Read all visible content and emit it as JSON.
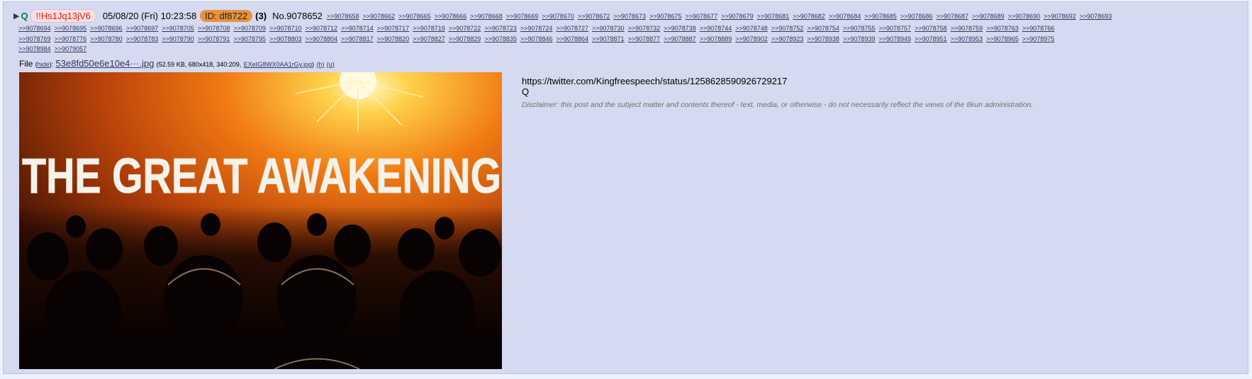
{
  "post": {
    "toggle_glyph": "▶",
    "name": "Q",
    "tripcode": "!!Hs1Jq13jV6",
    "datetime": "05/08/20 (Fri) 10:23:58",
    "id_label": "ID: df8722",
    "id_count": "(3)",
    "post_number": "No.9078652"
  },
  "backlinks": [
    [
      ">>9078658",
      ">>9078662",
      ">>9078665",
      ">>9078666",
      ">>9078668",
      ">>9078669",
      ">>9078670",
      ">>9078672",
      ">>9078673",
      ">>9078675",
      ">>9078677",
      ">>9078679",
      ">>9078681",
      ">>9078682",
      ">>9078684",
      ">>9078685",
      ">>9078686",
      ">>9078687",
      ">>9078689",
      ">>9078690",
      ">>9078692",
      ">>9078693"
    ],
    [
      ">>9078694",
      ">>9078695",
      ">>9078696",
      ">>9078697",
      ">>9078705",
      ">>9078708",
      ">>9078709",
      ">>9078710",
      ">>9078712",
      ">>9078714",
      ">>9078717",
      ">>9078719",
      ">>9078722",
      ">>9078723",
      ">>9078724",
      ">>9078727",
      ">>9078730",
      ">>9078732",
      ">>9078738",
      ">>9078744",
      ">>9078748",
      ">>9078752",
      ">>9078754",
      ">>9078755",
      ">>9078757",
      ">>9078758",
      ">>9078759",
      ">>9078763",
      ">>9078766"
    ],
    [
      ">>9078769",
      ">>9078776",
      ">>9078780",
      ">>9078783",
      ">>9078790",
      ">>9078791",
      ">>9078795",
      ">>9078803",
      ">>9078804",
      ">>9078817",
      ">>9078820",
      ">>9078827",
      ">>9078829",
      ">>9078835",
      ">>9078846",
      ">>9078864",
      ">>9078871",
      ">>9078877",
      ">>9078887",
      ">>9078889",
      ">>9078902",
      ">>9078923",
      ">>9078938",
      ">>9078939",
      ">>9078949",
      ">>9078951",
      ">>9078953",
      ">>9078965",
      ">>9078975"
    ],
    [
      ">>9078984",
      ">>9079057"
    ]
  ],
  "file": {
    "label": "File",
    "hide_open": "(",
    "hide_link": "hide",
    "hide_close": "):",
    "filename": "53e8fd50e6e10e4···.jpg",
    "meta_prefix": "(52.59 KB, 680x418, 340:209,",
    "original_name": "EXeIG8WX0AA1rGy.jpg",
    "meta_suffix": ")",
    "h_link": "(h)",
    "u_link": "(u)"
  },
  "image": {
    "headline": "THE GREAT AWAKENING"
  },
  "body": {
    "url": "https://twitter.com/Kingfreespeech/status/1258628590926729217",
    "signature": "Q",
    "disclaimer": "Disclaimer: this post and the subject matter and contents thereof - text, media, or otherwise - do not necessarily reflect the views of the 8kun administration."
  },
  "colors": {
    "page_bg": "#eef2ff",
    "post_bg": "#d6daf0",
    "name_green": "#117743",
    "trip_red": "#e01c1c",
    "id_orange": "#e8923c",
    "link": "#34345c"
  }
}
